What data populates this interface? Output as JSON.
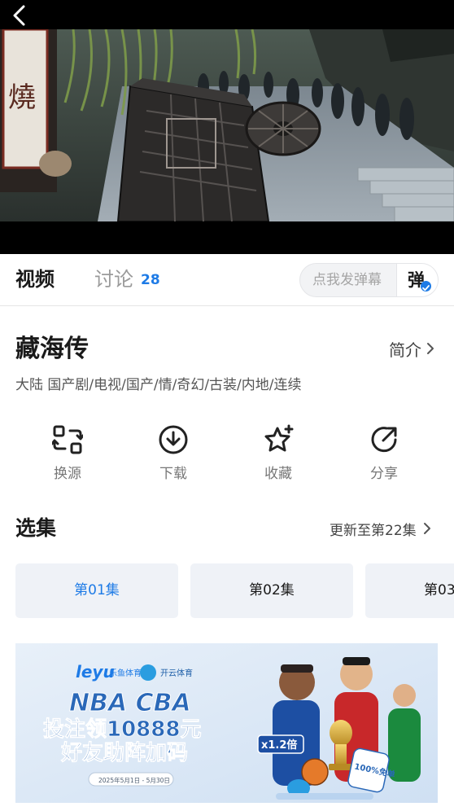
{
  "player": {
    "back_icon": "chevron-left-icon",
    "sign_text": "燒"
  },
  "tabs": {
    "video": "视频",
    "discuss": "讨论",
    "discuss_count": "28"
  },
  "danmaku": {
    "placeholder": "点我发弹幕",
    "button_label": "弹"
  },
  "show": {
    "title": "藏海传",
    "intro_label": "简介",
    "tags": "大陆  国产剧/电视/国产/情/奇幻/古装/内地/连续"
  },
  "actions": [
    {
      "label": "换源",
      "icon": "switch-source-icon"
    },
    {
      "label": "下载",
      "icon": "download-icon"
    },
    {
      "label": "收藏",
      "icon": "star-icon"
    },
    {
      "label": "分享",
      "icon": "share-icon"
    }
  ],
  "episodes": {
    "heading": "选集",
    "update_text": "更新至第22集",
    "items": [
      "第01集",
      "第02集",
      "第03"
    ]
  },
  "banner": {
    "brand_leyu": "leyu",
    "brand_leyu_cn": "乐鱼体育",
    "brand_kaiyun": "开云体育",
    "line1": "NBA CBA",
    "line2": "投注领10888元",
    "line3": "好友助阵加码",
    "multiplier": "x1.2倍",
    "badge": "100%免单",
    "date_range": "2025年5月1日 - 5月30日"
  },
  "colors": {
    "accent": "#1e7be6",
    "episode_bg": "#eff2f7",
    "banner_bg": "#dde8f5",
    "banner_title": "#2a68b8"
  }
}
